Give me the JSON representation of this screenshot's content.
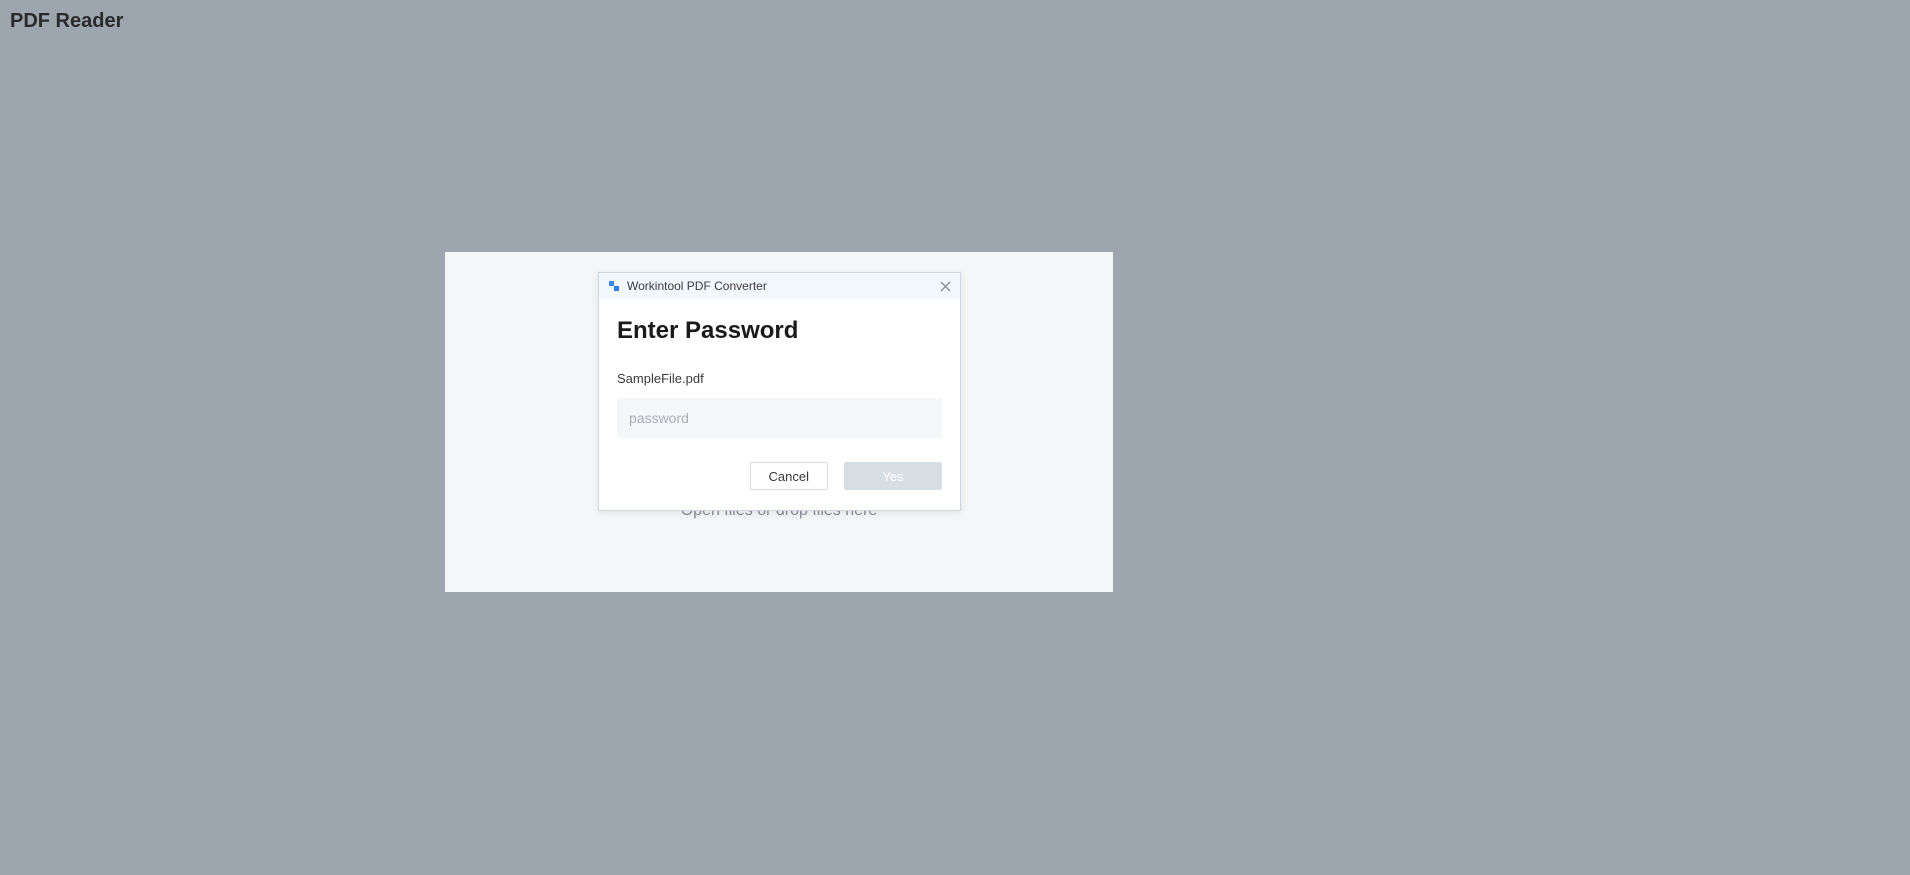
{
  "page": {
    "title": "PDF Reader"
  },
  "dropArea": {
    "text": "Open files or drop files here"
  },
  "dialog": {
    "titlebar": "Workintool PDF Converter",
    "heading": "Enter Password",
    "filename": "SampleFile.pdf",
    "passwordPlaceholder": "password",
    "cancelLabel": "Cancel",
    "yesLabel": "Yes"
  }
}
